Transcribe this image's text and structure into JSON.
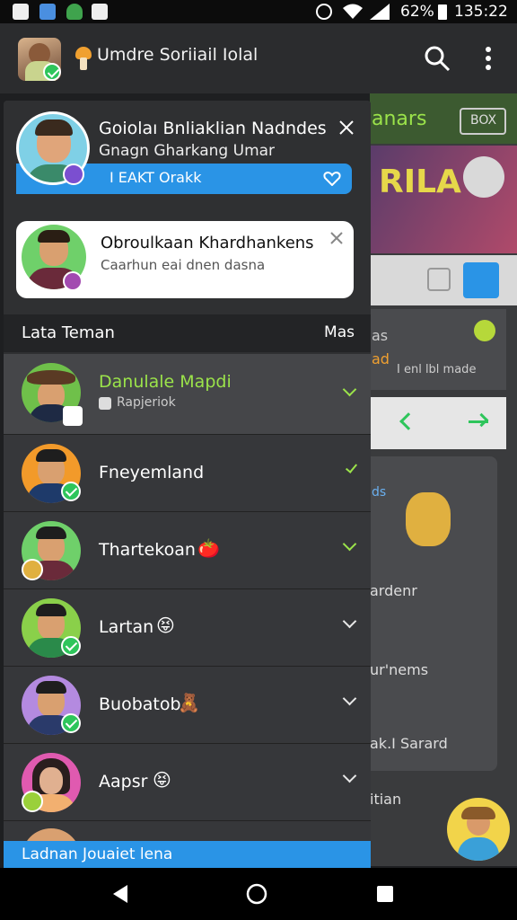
{
  "status_bar": {
    "battery": "62%",
    "time": "135:22"
  },
  "app_bar": {
    "title": "Umdre Soriiail Iolal",
    "icons": [
      "search-icon",
      "more-vert-icon"
    ]
  },
  "bg_app": {
    "header": "anars",
    "header_button": "BOX",
    "banner": "RILA",
    "card_line1": "as",
    "card_line2": "ad",
    "card_label": "I enl lbl made",
    "list": [
      "ardenr",
      "ur'nems",
      "ak.I Sarard",
      "itian"
    ],
    "ads_text": "ds"
  },
  "drawer": {
    "profile": {
      "name": "Goiolaı Bnliaklian Nadndes",
      "subtitle": "Gnagn Gharkang Umar",
      "action_label": "I EAKT Orakk"
    },
    "notification": {
      "title": "Obroulkaan Khardhankens",
      "subtitle": "Caarhun eai dnen dasna"
    },
    "section": {
      "title": "Lata Teman",
      "more": "Mas"
    },
    "friends": [
      {
        "name": "Danulale Mapdi",
        "status": "Rapjeriok",
        "emoji": ""
      },
      {
        "name": "Fneyemland",
        "status": "",
        "emoji": ""
      },
      {
        "name": "Thartekoan",
        "status": "",
        "emoji": "🍅"
      },
      {
        "name": "Lartan",
        "status": "",
        "emoji": "😝"
      },
      {
        "name": "Buobatob",
        "status": "",
        "emoji": "🧸"
      },
      {
        "name": "Aapsr",
        "status": "",
        "emoji": "😝"
      }
    ],
    "bottom_label": "Ladnan Jouaiet lena"
  },
  "colors": {
    "accent_blue": "#2a94e6",
    "green": "#2ec55b",
    "highlight_text": "#9be34a"
  }
}
